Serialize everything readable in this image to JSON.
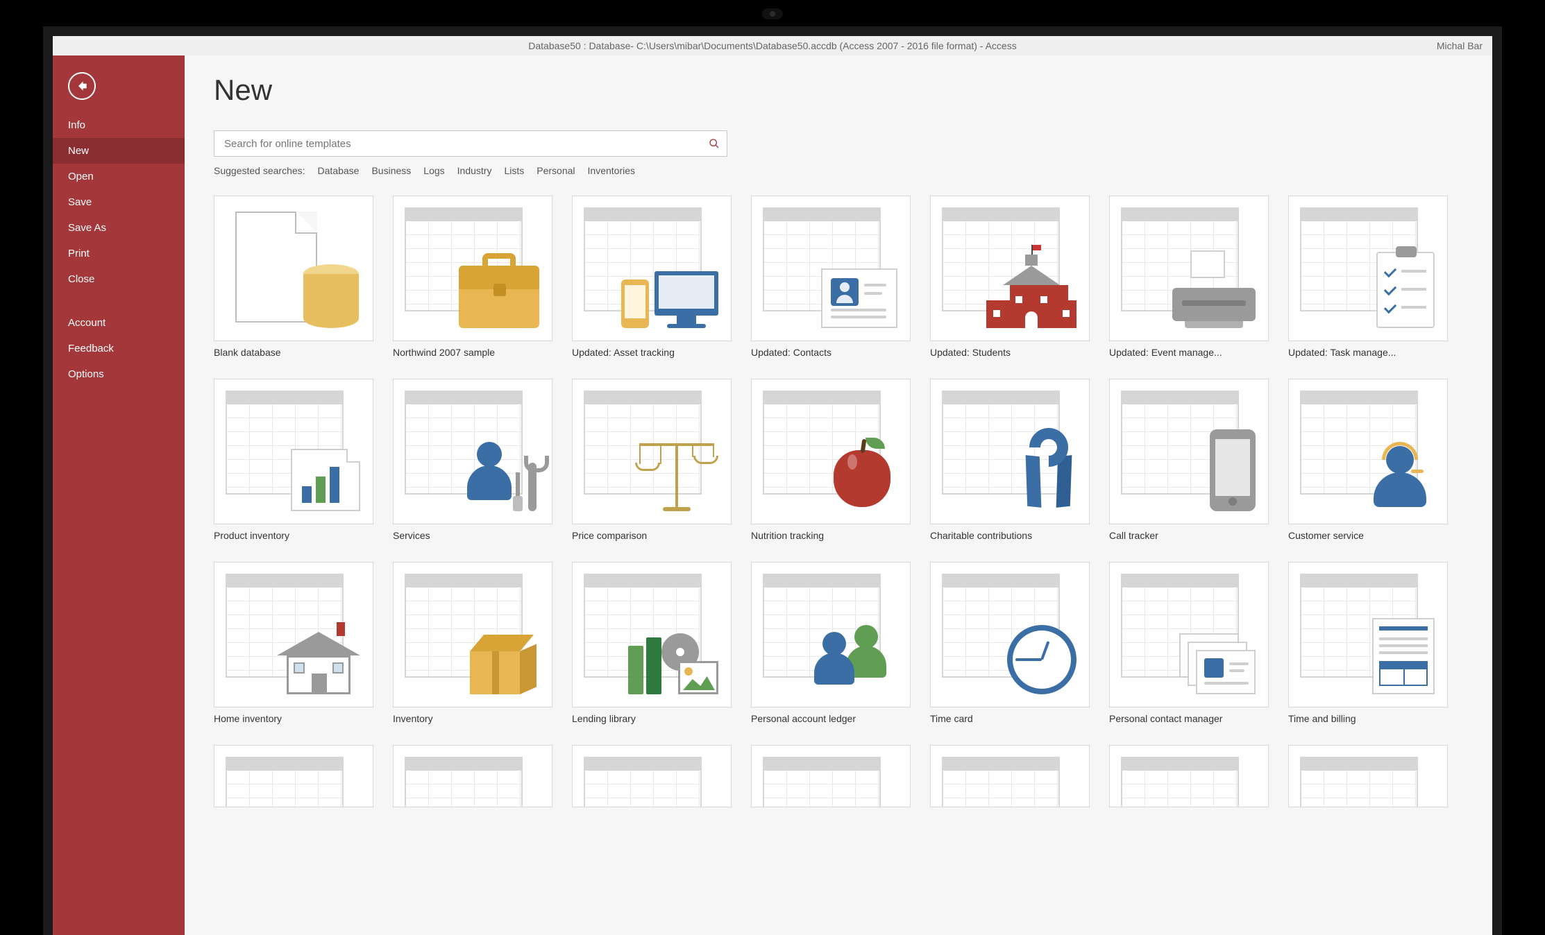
{
  "colors": {
    "accent": "#a4373a",
    "accent_dark": "#8b2e31"
  },
  "titlebar": {
    "text": "Database50 : Database- C:\\Users\\mibar\\Documents\\Database50.accdb (Access 2007 - 2016 file format)  -  Access",
    "user": "Michal Bar"
  },
  "sidebar": {
    "items": [
      {
        "label": "Info"
      },
      {
        "label": "New",
        "active": true
      },
      {
        "label": "Open"
      },
      {
        "label": "Save"
      },
      {
        "label": "Save As"
      },
      {
        "label": "Print"
      },
      {
        "label": "Close"
      }
    ],
    "items2": [
      {
        "label": "Account"
      },
      {
        "label": "Feedback"
      },
      {
        "label": "Options"
      }
    ]
  },
  "page": {
    "title": "New",
    "search_placeholder": "Search for online templates",
    "suggest_label": "Suggested searches:",
    "suggestions": [
      "Database",
      "Business",
      "Logs",
      "Industry",
      "Lists",
      "Personal",
      "Inventories"
    ]
  },
  "templates": [
    {
      "label": "Blank database",
      "icon": "blank"
    },
    {
      "label": "Northwind 2007 sample",
      "icon": "briefcase"
    },
    {
      "label": "Updated: Asset tracking",
      "icon": "devices"
    },
    {
      "label": "Updated: Contacts",
      "icon": "contact"
    },
    {
      "label": "Updated: Students",
      "icon": "school"
    },
    {
      "label": "Updated: Event manage...",
      "icon": "printer"
    },
    {
      "label": "Updated: Task manage...",
      "icon": "checklist"
    },
    {
      "label": "Product inventory",
      "icon": "barchart"
    },
    {
      "label": "Services",
      "icon": "svcperson"
    },
    {
      "label": "Price comparison",
      "icon": "scale"
    },
    {
      "label": "Nutrition tracking",
      "icon": "apple"
    },
    {
      "label": "Charitable contributions",
      "icon": "ribbon"
    },
    {
      "label": "Call tracker",
      "icon": "cellphone"
    },
    {
      "label": "Customer service",
      "icon": "headset"
    },
    {
      "label": "Home inventory",
      "icon": "house"
    },
    {
      "label": "Inventory",
      "icon": "box"
    },
    {
      "label": "Lending library",
      "icon": "library"
    },
    {
      "label": "Personal account ledger",
      "icon": "people"
    },
    {
      "label": "Time card",
      "icon": "clock"
    },
    {
      "label": "Personal contact manager",
      "icon": "contactstack"
    },
    {
      "label": "Time and billing",
      "icon": "invoice"
    },
    {
      "label": "",
      "icon": "generic",
      "partial": true
    },
    {
      "label": "",
      "icon": "generic",
      "partial": true
    },
    {
      "label": "",
      "icon": "generic",
      "partial": true
    },
    {
      "label": "",
      "icon": "generic",
      "partial": true
    },
    {
      "label": "",
      "icon": "generic",
      "partial": true
    },
    {
      "label": "",
      "icon": "generic",
      "partial": true
    },
    {
      "label": "",
      "icon": "generic",
      "partial": true
    }
  ]
}
